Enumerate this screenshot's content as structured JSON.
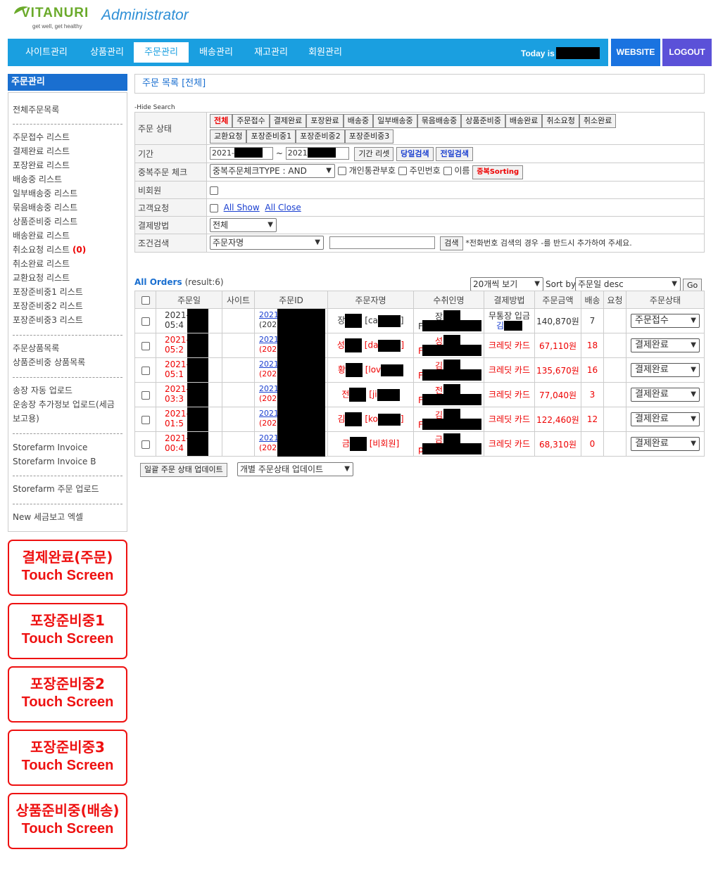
{
  "header": {
    "logo_text": "VITANURI",
    "logo_tagline": "get well, get healthy",
    "title": "Administrator",
    "nav": [
      "사이트관리",
      "상품관리",
      "주문관리",
      "배송관리",
      "재고관리",
      "회원관리"
    ],
    "today_label": "Today is",
    "website_label": "WEBSITE",
    "logout_label": "LOGOUT"
  },
  "sidebar": {
    "title": "주문관리",
    "links": [
      "전체주문목록",
      "주문접수 리스트",
      "결제완료 리스트",
      "포장완료 리스트",
      "배송중 리스트",
      "일부배송중 리스트",
      "묶음배송중 리스트",
      "상품준비중 리스트",
      "배송완료 리스트",
      "취소요청 리스트",
      "취소완료 리스트",
      "교환요청 리스트",
      "포장준비중1 리스트",
      "포장준비중2 리스트",
      "포장준비중3 리스트",
      "주문상품목록",
      "상품준비중 상품목록",
      "송장 자동 업로드",
      "운송장 추가정보 업로드(세금",
      "보고용)",
      "Storefarm Invoice",
      "Storefarm Invoice B",
      "Storefarm 주문 업로드",
      "New 세금보고 엑셀"
    ],
    "cancel_request_count": "(0)",
    "touch_buttons": [
      {
        "line1": "결제완료(주문)",
        "line2": "Touch Screen"
      },
      {
        "line1": "포장준비중1",
        "line2": "Touch Screen"
      },
      {
        "line1": "포장준비중2",
        "line2": "Touch Screen"
      },
      {
        "line1": "포장준비중3",
        "line2": "Touch Screen"
      },
      {
        "line1": "상품준비중(배송)",
        "line2": "Touch Screen"
      }
    ]
  },
  "main": {
    "page_title": "주문 목록 [전체]",
    "hide_search": "-Hide Search",
    "search": {
      "status_label": "주문 상태",
      "status_buttons": [
        "전체",
        "주문접수",
        "결제완료",
        "포장완료",
        "배송중",
        "일부배송중",
        "묶음배송중",
        "상품준비중",
        "배송완료",
        "취소요청",
        "취소완료",
        "교환요청",
        "포장준비중1",
        "포장준비중2",
        "포장준비중3"
      ],
      "period_label": "기간",
      "date_from": "2021-",
      "date_sep": "~",
      "date_to": "2021",
      "period_reset": "기간 리셋",
      "today_search": "당일검색",
      "yesterday_search": "전일검색",
      "dup_label": "중복주문 체크",
      "dup_select": "중복주문체크TYPE : AND",
      "dup_options": [
        "개인통관부호",
        "주민번호",
        "이름"
      ],
      "dup_sort": "중복Sorting",
      "nonmember_label": "비회원",
      "request_label": "고객요청",
      "all_show": "All Show",
      "all_close": "All Close",
      "payment_label": "결제방법",
      "payment_select": "전체",
      "cond_label": "조건검색",
      "cond_select": "주문자명",
      "search_button": "검색",
      "search_note": "*전화번호 검색의 경우 -를 반드시 추가하여 주세요."
    },
    "orders": {
      "title": "All Orders",
      "result": "(result:6)",
      "per_page": "20개씩 보기",
      "sort_label": "Sort by",
      "sort_select": "주문일 desc",
      "go": "Go",
      "columns": [
        "주문일",
        "사이트",
        "주문ID",
        "주문자명",
        "수취인명",
        "결제방법",
        "주문금액",
        "배송",
        "요청",
        "주문상태"
      ],
      "rows": [
        {
          "date1": "2021-",
          "date2": "05:4",
          "oid1": "2021",
          "oid2": "(2021",
          "name_pre": "장",
          "name_tag": "[ca",
          "name_end": "]",
          "recv": "장",
          "recv_pre": "F",
          "pay": "무통장 입금",
          "pay2": "김",
          "amount": "140,870원",
          "ship": "7",
          "status": "주문접수",
          "red": false
        },
        {
          "date1": "2021-",
          "date2": "05:2",
          "oid1": "2021",
          "oid2": "(2021",
          "name_pre": "성",
          "name_tag": "[da",
          "name_end": "]",
          "recv": "성",
          "recv_pre": "F",
          "pay": "크레딧 카드",
          "pay2": "",
          "amount": "67,110원",
          "ship": "18",
          "status": "결제완료",
          "red": true
        },
        {
          "date1": "2021-",
          "date2": "05:1",
          "oid1": "2021",
          "oid2": "(2021",
          "name_pre": "황",
          "name_tag": "[lov",
          "name_end": "",
          "recv": "김",
          "recv_pre": "F",
          "pay": "크레딧 카드",
          "pay2": "",
          "amount": "135,670원",
          "ship": "16",
          "status": "결제완료",
          "red": true
        },
        {
          "date1": "2021-",
          "date2": "03:3",
          "oid1": "2021",
          "oid2": "(2021",
          "name_pre": "전",
          "name_tag": "[ji",
          "name_end": "",
          "recv": "전",
          "recv_pre": "F",
          "pay": "크레딧 카드",
          "pay2": "",
          "amount": "77,040원",
          "ship": "3",
          "status": "결제완료",
          "red": true
        },
        {
          "date1": "2021-",
          "date2": "01:5",
          "oid1": "2021",
          "oid2": "(2021",
          "name_pre": "김",
          "name_tag": "[ko",
          "name_end": "]",
          "recv": "김",
          "recv_pre": "F",
          "pay": "크레딧 카드",
          "pay2": "",
          "amount": "122,460원",
          "ship": "12",
          "status": "결제완료",
          "red": true
        },
        {
          "date1": "2021-",
          "date2": "00:4",
          "oid1": "2021",
          "oid2": "(2021",
          "name_pre": "금",
          "name_tag": "[비회원]",
          "name_end": "",
          "recv": "금",
          "recv_pre": "p",
          "pay": "크레딧 카드",
          "pay2": "",
          "amount": "68,310원",
          "ship": "0",
          "status": "결제완료",
          "red": true
        }
      ],
      "bulk_update": "일괄 주문 상태 업데이트",
      "individual_update": "개별 주문상태 업데이트"
    }
  },
  "colors": {
    "nav": "#1a9fe0",
    "accent": "#1a6fd0",
    "alert": "#e11111"
  }
}
